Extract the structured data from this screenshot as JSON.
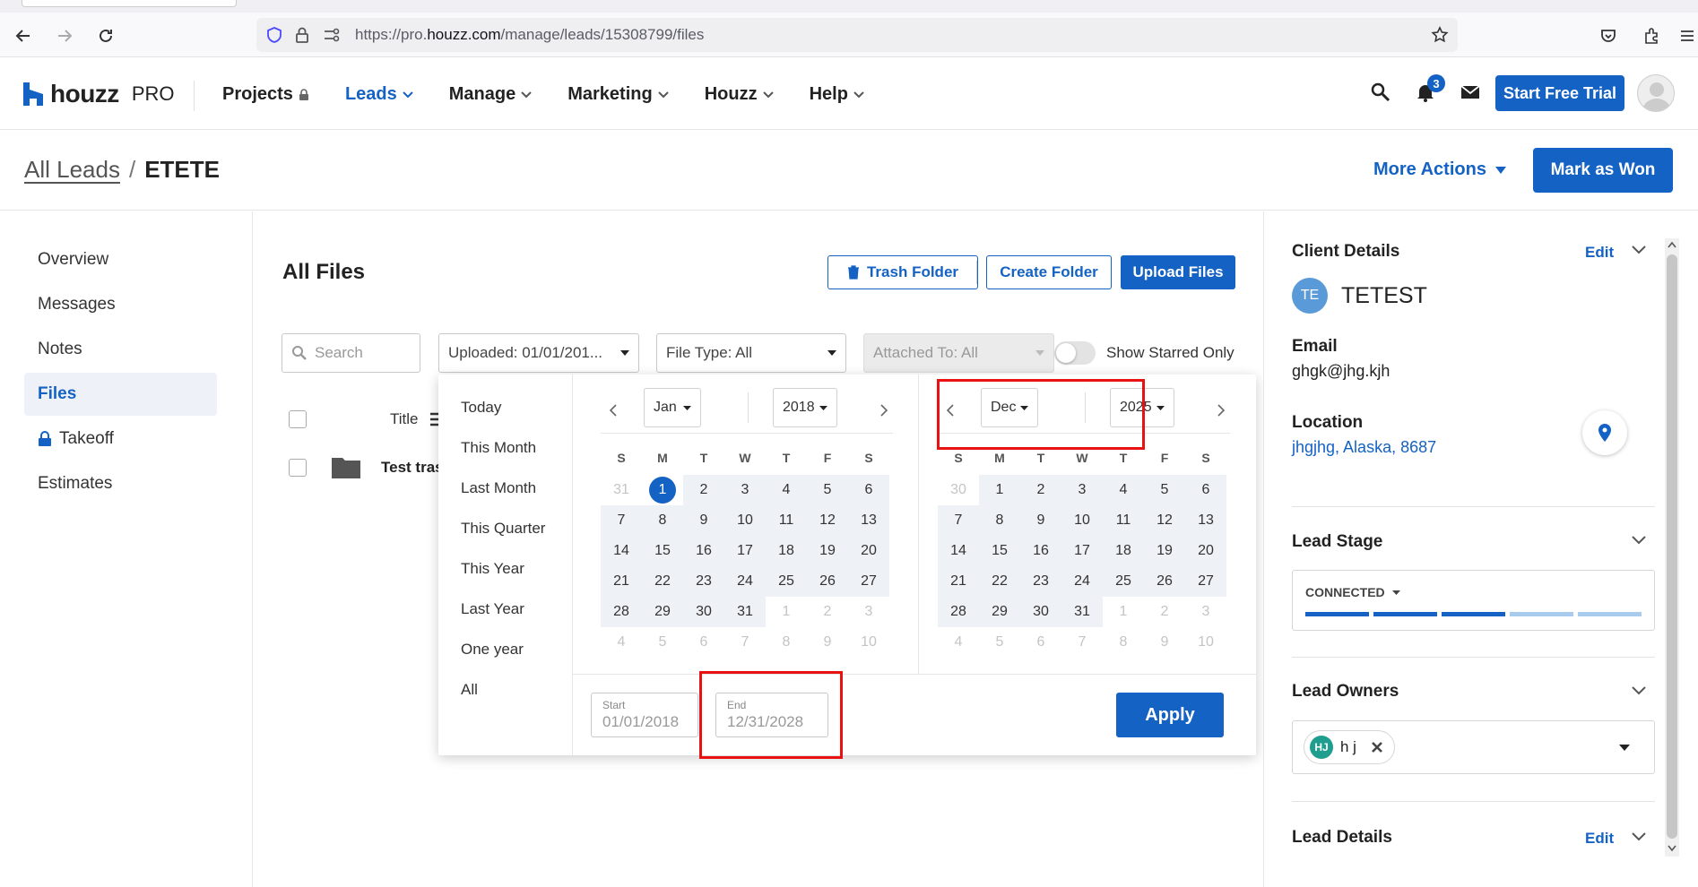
{
  "browser": {
    "url_prefix": "https://pro.",
    "url_domain": "houzz.com",
    "url_path": "/manage/leads/15308799/files"
  },
  "header": {
    "logo_text": "houzz",
    "logo_suffix": "PRO",
    "nav": [
      {
        "label": "Projects"
      },
      {
        "label": "Leads"
      },
      {
        "label": "Manage"
      },
      {
        "label": "Marketing"
      },
      {
        "label": "Houzz"
      },
      {
        "label": "Help"
      }
    ],
    "notification_count": "3",
    "trial_button": "Start Free Trial",
    "accent_color": "#1462c4"
  },
  "breadcrumb": {
    "parent": "All Leads",
    "separator": "/",
    "current": "ETETE",
    "more_actions": "More Actions",
    "mark_won": "Mark as Won"
  },
  "sidebar": {
    "items": [
      {
        "label": "Overview"
      },
      {
        "label": "Messages"
      },
      {
        "label": "Notes"
      },
      {
        "label": "Files"
      },
      {
        "label": "Takeoff"
      },
      {
        "label": "Estimates"
      }
    ]
  },
  "files": {
    "title": "All Files",
    "trash_button": "Trash Folder",
    "create_button": "Create Folder",
    "upload_button": "Upload Files",
    "search_placeholder": "Search",
    "uploaded_filter": "Uploaded: 01/01/201...",
    "filetype_filter": "File Type: All",
    "attached_filter": "Attached To: All",
    "starred_label": "Show Starred Only",
    "column_title": "Title",
    "row_name": "Test tras"
  },
  "datepicker": {
    "presets": [
      "Today",
      "This Month",
      "Last Month",
      "This Quarter",
      "This Year",
      "Last Year",
      "One year",
      "All"
    ],
    "weekdays": [
      "S",
      "M",
      "T",
      "W",
      "T",
      "F",
      "S"
    ],
    "left": {
      "month": "Jan",
      "year": "2018",
      "days": [
        [
          "31",
          "1",
          "2",
          "3",
          "4",
          "5",
          "6"
        ],
        [
          "7",
          "8",
          "9",
          "10",
          "11",
          "12",
          "13"
        ],
        [
          "14",
          "15",
          "16",
          "17",
          "18",
          "19",
          "20"
        ],
        [
          "21",
          "22",
          "23",
          "24",
          "25",
          "26",
          "27"
        ],
        [
          "28",
          "29",
          "30",
          "31",
          "1",
          "2",
          "3"
        ],
        [
          "4",
          "5",
          "6",
          "7",
          "8",
          "9",
          "10"
        ]
      ]
    },
    "right": {
      "month": "Dec",
      "year": "2025",
      "days": [
        [
          "30",
          "1",
          "2",
          "3",
          "4",
          "5",
          "6"
        ],
        [
          "7",
          "8",
          "9",
          "10",
          "11",
          "12",
          "13"
        ],
        [
          "14",
          "15",
          "16",
          "17",
          "18",
          "19",
          "20"
        ],
        [
          "21",
          "22",
          "23",
          "24",
          "25",
          "26",
          "27"
        ],
        [
          "28",
          "29",
          "30",
          "31",
          "1",
          "2",
          "3"
        ],
        [
          "4",
          "5",
          "6",
          "7",
          "8",
          "9",
          "10"
        ]
      ]
    },
    "start_label": "Start",
    "start_value": "01/01/2018",
    "end_label": "End",
    "end_value": "12/31/2028",
    "apply": "Apply"
  },
  "client": {
    "section_title": "Client Details",
    "edit": "Edit",
    "initials": "TE",
    "name": "TETEST",
    "email_label": "Email",
    "email": "ghgk@jhg.kjh",
    "location_label": "Location",
    "location": "jhgjhg, Alaska, 8687",
    "stage_title": "Lead Stage",
    "stage_value": "CONNECTED",
    "stage_progress": 3,
    "owners_title": "Lead Owners",
    "owner_initials": "HJ",
    "owner_name": "h j",
    "details_title": "Lead Details",
    "details_edit": "Edit"
  }
}
